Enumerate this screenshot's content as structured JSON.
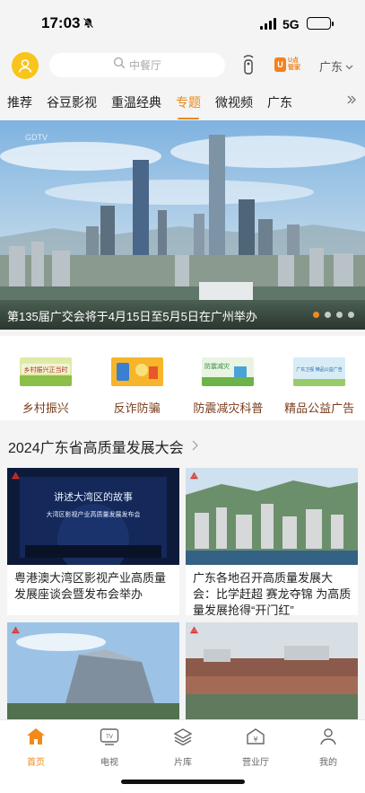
{
  "status_bar": {
    "time": "17:03",
    "network": "5G",
    "mute_icon": "bell-slash-icon"
  },
  "header": {
    "avatar_icon": "user-icon",
    "search_placeholder": "中餐厅",
    "remote_icon": "remote-control-icon",
    "udian_label_line1": "U点",
    "udian_label_line2": "管家",
    "region": "广东",
    "accent": "#f08a1a"
  },
  "tabs": [
    {
      "label": "推荐"
    },
    {
      "label": "谷豆影视"
    },
    {
      "label": "重温经典"
    },
    {
      "label": "专题",
      "active": true
    },
    {
      "label": "微视频"
    },
    {
      "label": "广东"
    }
  ],
  "banner": {
    "caption": "第135届广交会将于4月15日至5月5日在广州举办",
    "slides": 4,
    "active_slide": 1
  },
  "quick_entries": [
    {
      "label": "乡村振兴",
      "thumb_text": "乡村振兴正当时"
    },
    {
      "label": "反诈防骗",
      "thumb_text": ""
    },
    {
      "label": "防震减灾科普",
      "thumb_text": "防震减灾"
    },
    {
      "label": "精品公益广告",
      "thumb_text": "广东卫视 精品公益广告"
    }
  ],
  "section": {
    "title": "2024广东省高质量发展大会"
  },
  "cards": [
    {
      "caption": "粤港澳大湾区影视产业高质量发展座谈会暨发布会举办",
      "thumb_text_1": "讲述大湾区的故事",
      "thumb_text_2": "大湾区影视产业高质量发展发布会"
    },
    {
      "caption": "广东各地召开高质量发展大会：比学赶超 赛龙夺锦 为高质量发展抢得“开门红”",
      "thumb_text_1": "",
      "thumb_text_2": ""
    },
    {
      "caption": "",
      "thumb_text_1": "",
      "thumb_text_2": ""
    },
    {
      "caption": "",
      "thumb_text_1": "",
      "thumb_text_2": ""
    }
  ],
  "bottom_nav": [
    {
      "label": "首页",
      "icon": "home-icon",
      "active": true
    },
    {
      "label": "电视",
      "icon": "tv-icon"
    },
    {
      "label": "片库",
      "icon": "layers-icon"
    },
    {
      "label": "营业厅",
      "icon": "store-icon"
    },
    {
      "label": "我的",
      "icon": "person-icon"
    }
  ]
}
